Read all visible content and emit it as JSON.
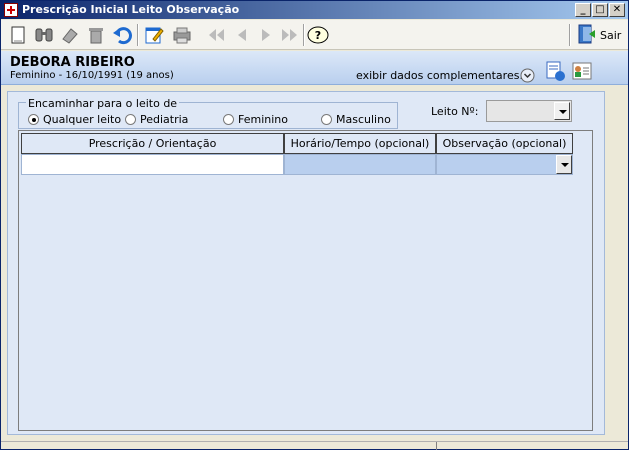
{
  "window": {
    "title": "Prescrição Inicial Leito Observação",
    "minimize_label": "_",
    "maximize_label": "□",
    "close_label": "✕"
  },
  "toolbar": {
    "exit_label": "Sair"
  },
  "patient": {
    "name": "DEBORA RIBEIRO",
    "info": "Feminino - 16/10/1991 (19 anos)",
    "more_label": "exibir dados complementares..."
  },
  "routing": {
    "group_label": "Encaminhar para o leito de",
    "options": [
      {
        "label": "Qualquer leito",
        "selected": true
      },
      {
        "label": "Pediatria",
        "selected": false
      },
      {
        "label": "Feminino",
        "selected": false
      },
      {
        "label": "Masculino",
        "selected": false
      }
    ]
  },
  "bed": {
    "label": "Leito Nº:",
    "value": ""
  },
  "grid": {
    "columns": [
      "Prescrição / Orientação",
      "Horário/Tempo (opcional)",
      "Observação (opcional)"
    ],
    "rows": [
      [
        "",
        "",
        ""
      ]
    ]
  },
  "colors": {
    "title_gradient_start": "#0a246a",
    "title_gradient_end": "#a6caf0",
    "panel_bg": "#dfe8f6",
    "header_band": "#b9cfee",
    "selected_cell": "#b9cfee"
  }
}
